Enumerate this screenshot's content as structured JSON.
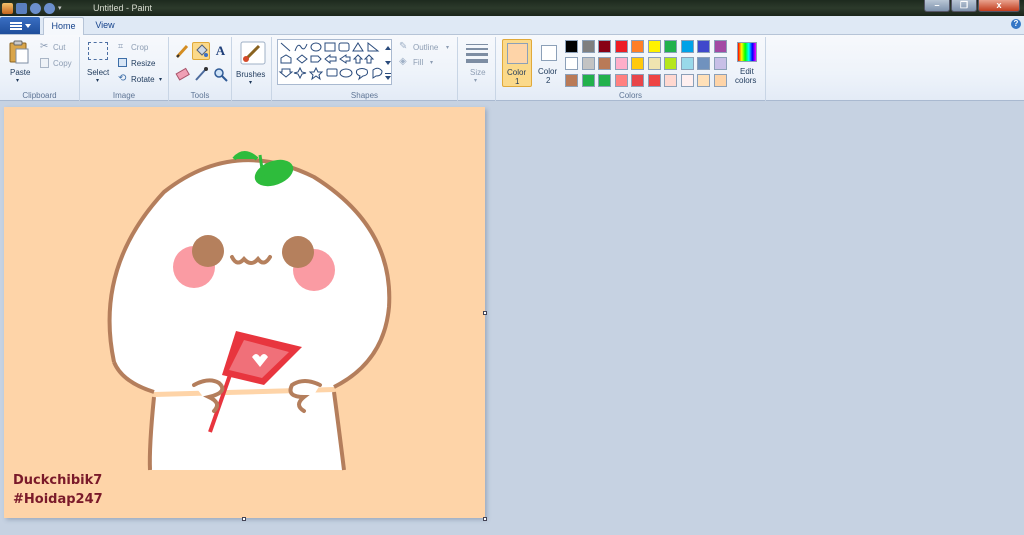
{
  "window": {
    "title": "Untitled - Paint",
    "minimize": "–",
    "maximize": "❐",
    "close": "x"
  },
  "tabs": {
    "home": "Home",
    "view": "View",
    "help": "?"
  },
  "clipboard": {
    "paste": "Paste",
    "cut": "Cut",
    "copy": "Copy",
    "group": "Clipboard"
  },
  "image": {
    "select": "Select",
    "crop": "Crop",
    "resize": "Resize",
    "rotate": "Rotate",
    "group": "Image"
  },
  "tools": {
    "group": "Tools"
  },
  "brushes": {
    "label": "Brushes"
  },
  "shapes": {
    "outline": "Outline",
    "fill": "Fill",
    "group": "Shapes"
  },
  "size": {
    "label": "Size"
  },
  "colors": {
    "color1_label": "Color 1",
    "color1_line1": "Color",
    "color1_line2": "1",
    "color2_line1": "Color",
    "color2_line2": "2",
    "edit_line1": "Edit",
    "edit_line2": "colors",
    "group": "Colors",
    "color1": "#fed4a8",
    "color2": "#ffffff",
    "palette_row1": [
      "#000000",
      "#7f7f7f",
      "#880015",
      "#ed1c24",
      "#ff7f27",
      "#fff200",
      "#22b14c",
      "#00a2e8",
      "#3f48cc",
      "#a349a4"
    ],
    "palette_row2": [
      "#ffffff",
      "#c3c3c3",
      "#b97a57",
      "#ffaec9",
      "#ffc90e",
      "#efe4b0",
      "#b5e61d",
      "#99d9ea",
      "#7092be",
      "#c8bfe7"
    ],
    "palette_row3": [
      "#b97a57",
      "#22b14c",
      "#22b14c",
      "#ff8080",
      "#e8454a",
      "#ee4444",
      "#ffd8d0",
      "#fff0f0",
      "#ffe0b8",
      "#fed4a8"
    ]
  },
  "canvas": {
    "bg": "#fed4a8",
    "watermark_line1": "Duckchibik7",
    "watermark_line2": "#Hoidap247"
  }
}
